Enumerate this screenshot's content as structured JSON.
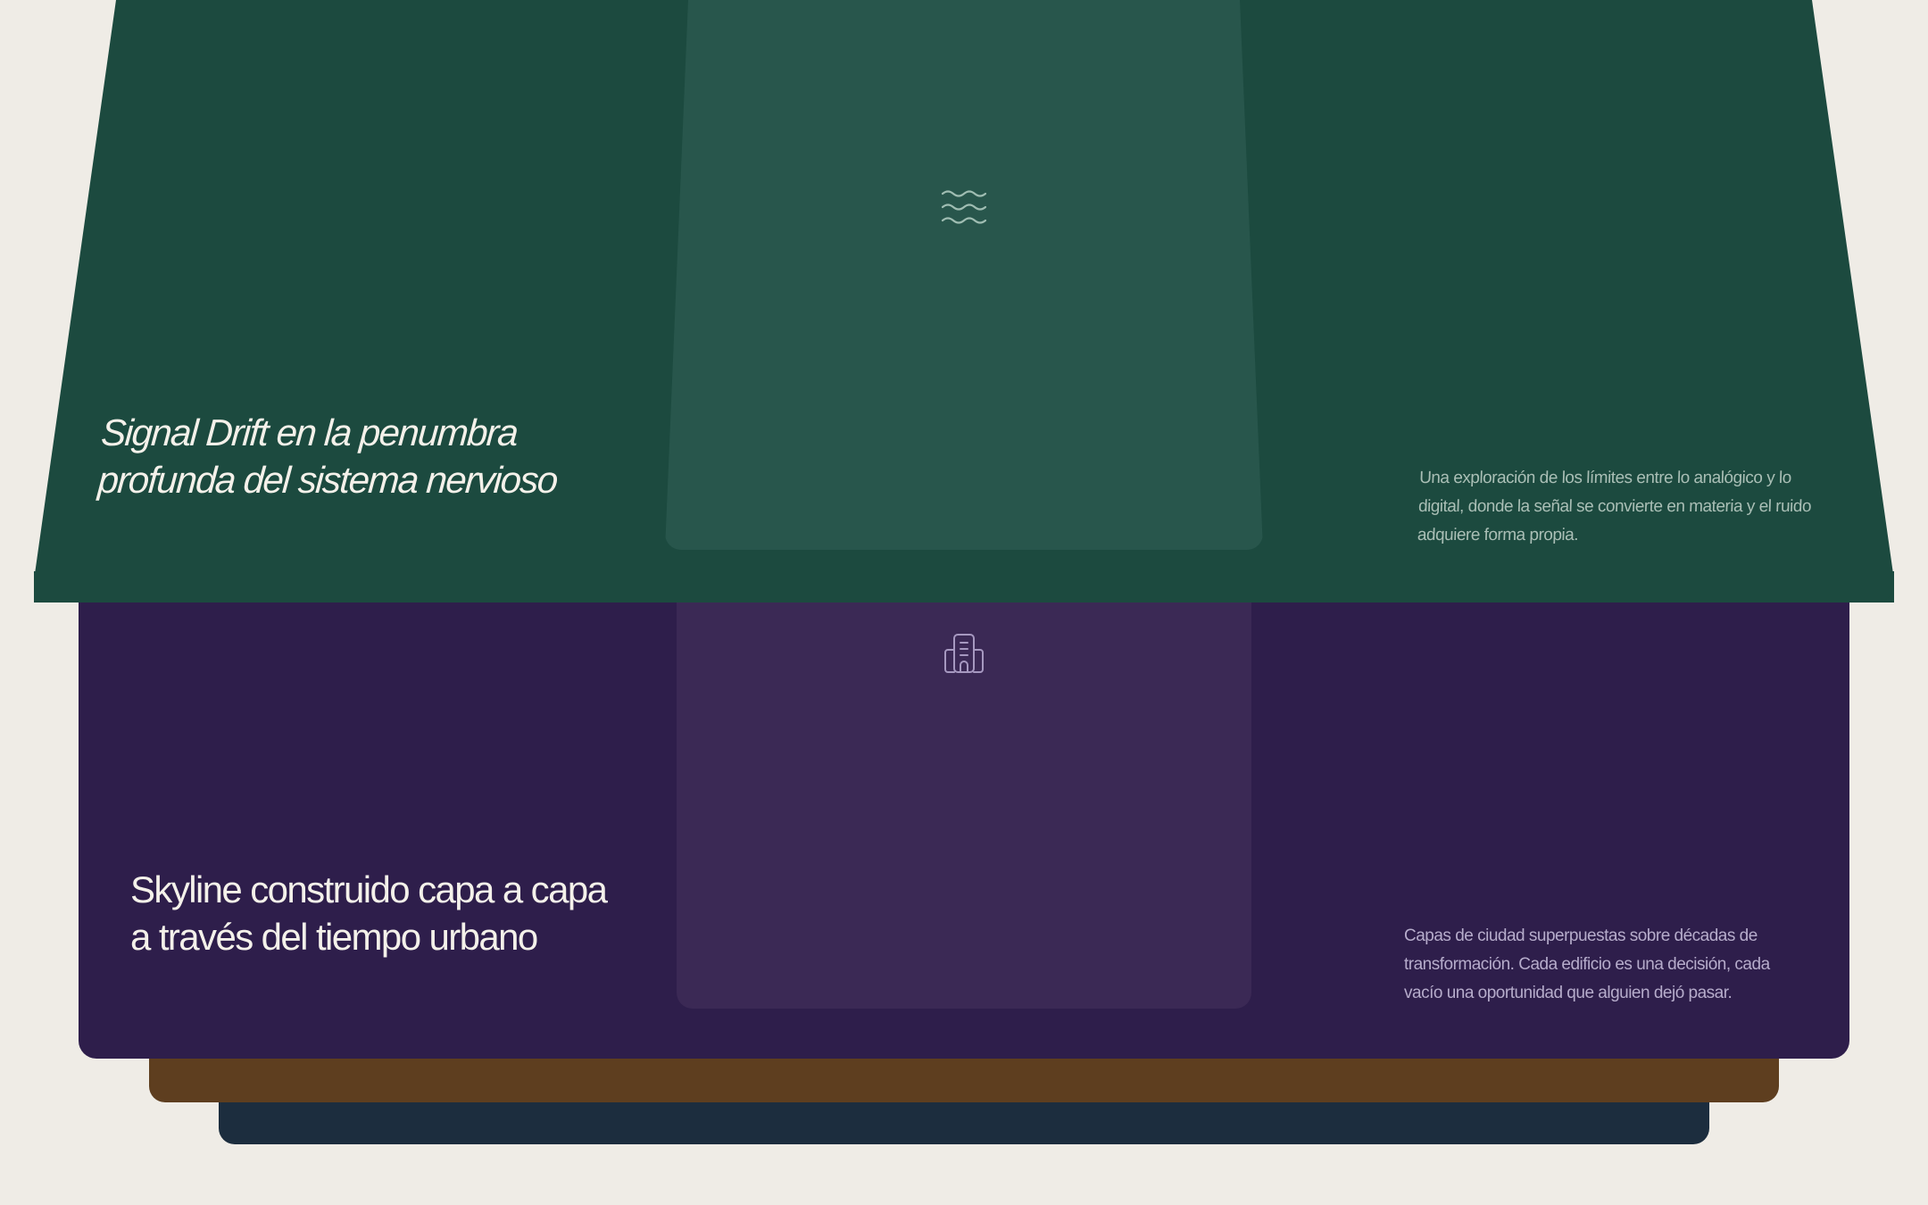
{
  "colors": {
    "background": "#EFECE6",
    "navy": "#1C2D3E",
    "brown": "#5E3E1F",
    "purple": "#2E1E4B",
    "purple_panel": "#3B2955",
    "green": "#1C4A3F",
    "green_panel": "#28564C",
    "green_icon": "#9FBDB2",
    "purple_icon": "#A698C0"
  },
  "cards": [
    {
      "id": "signal-drift",
      "title": "Signal Drift en la penumbra profunda del sistema nervioso",
      "description": "Una exploración de los límites entre lo analógico y lo digital, donde la señal se convierte en materia y el ruido adquiere forma propia.",
      "icon": "waves-icon"
    },
    {
      "id": "skyline",
      "title": "Skyline construido capa a capa a través del tiempo urbano",
      "description": "Capas de ciudad superpuestas sobre décadas de transformación. Cada edificio es una decisión, cada vacío una oportunidad que alguien dejó pasar.",
      "icon": "building-icon"
    }
  ]
}
